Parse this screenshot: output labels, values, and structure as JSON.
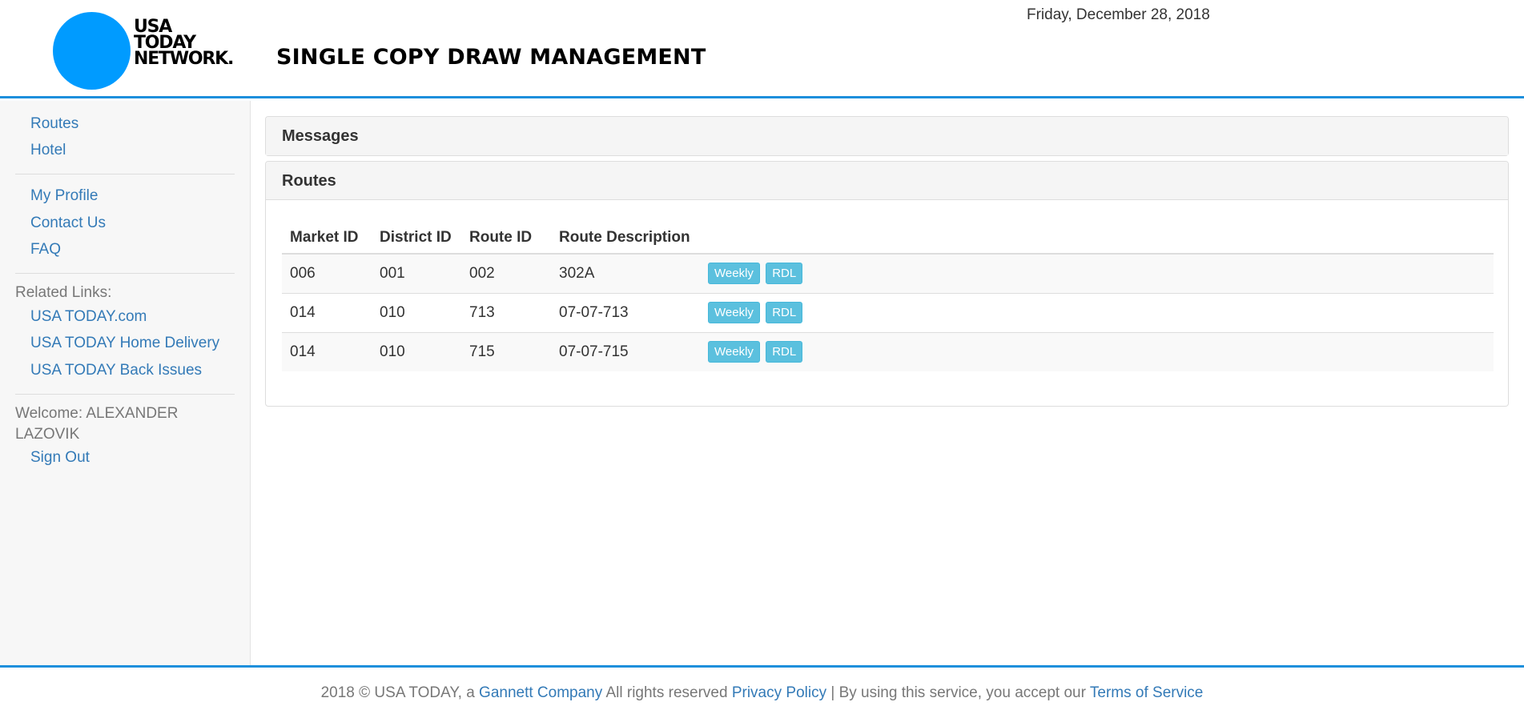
{
  "header": {
    "logo_lines": [
      "USA",
      "TODAY",
      "NETWORK."
    ],
    "title": "SINGLE COPY DRAW MANAGEMENT",
    "date": "Friday, December 28, 2018",
    "logo_color": "#009bff",
    "accent_color": "#1e8fdc"
  },
  "sidebar": {
    "nav_main": [
      {
        "label": "Routes"
      },
      {
        "label": "Hotel"
      }
    ],
    "nav_account": [
      {
        "label": "My Profile"
      },
      {
        "label": "Contact Us"
      },
      {
        "label": "FAQ"
      }
    ],
    "related_label": "Related Links:",
    "related_links": [
      {
        "label": "USA TODAY.com"
      },
      {
        "label": "USA TODAY Home Delivery"
      },
      {
        "label": "USA TODAY Back Issues"
      }
    ],
    "welcome_prefix": "Welcome: ALEXANDER",
    "welcome_name": "LAZOVIK",
    "sign_out": "Sign Out"
  },
  "messages_panel": {
    "title": "Messages"
  },
  "routes_panel": {
    "title": "Routes",
    "columns": [
      "Market ID",
      "District ID",
      "Route ID",
      "Route Description"
    ],
    "rows": [
      {
        "market_id": "006",
        "district_id": "001",
        "route_id": "002",
        "description": "302A",
        "btn_weekly": "Weekly",
        "btn_rdl": "RDL"
      },
      {
        "market_id": "014",
        "district_id": "010",
        "route_id": "713",
        "description": "07-07-713",
        "btn_weekly": "Weekly",
        "btn_rdl": "RDL"
      },
      {
        "market_id": "014",
        "district_id": "010",
        "route_id": "715",
        "description": "07-07-715",
        "btn_weekly": "Weekly",
        "btn_rdl": "RDL"
      }
    ]
  },
  "footer": {
    "text1": "2018 © USA TODAY, a ",
    "link1": "Gannett Company",
    "text2": " All rights reserved ",
    "link2": "Privacy Policy",
    "text3": " | By using this service, you accept our ",
    "link3": "Terms of Service"
  }
}
